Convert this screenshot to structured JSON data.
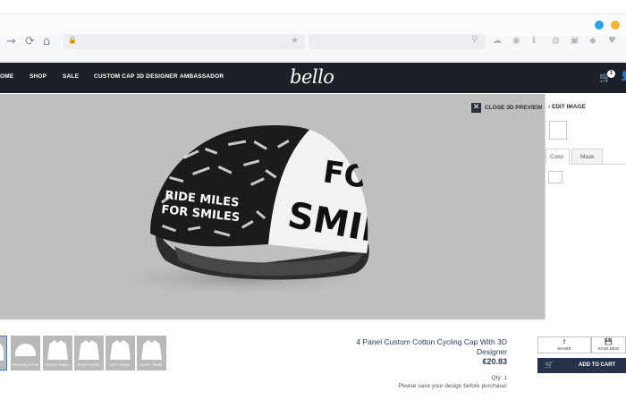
{
  "browser": {
    "nav_icons": {
      "forward": "→",
      "reload": "⟳",
      "home": "⌂"
    },
    "url_icon": "🔒",
    "bookmark_star": "★",
    "search_icon": "⚲",
    "toolbar_icons": [
      "☁",
      "◉",
      "ℹ",
      "◍",
      "▣",
      "◆",
      "♥"
    ],
    "dot_colors": [
      "#2aa5e4",
      "#f2b233"
    ]
  },
  "site_nav": {
    "items": [
      "OME",
      "SHOP",
      "SALE",
      "CUSTOM CAP 3D DESIGNER",
      "AMBASSADOR"
    ],
    "logo": "bello",
    "cart_icon": "🛒",
    "cart_count": "1",
    "user_icon": "👤"
  },
  "viewer": {
    "close_icon": "✕",
    "close_label": "CLOSE 3D PREVIEW",
    "cap_text_side": [
      "RIDE MILES",
      "FOR SMILES"
    ],
    "cap_text_front": [
      "FO",
      "SMIL"
    ]
  },
  "side_panel": {
    "edit_image_chevron": "›",
    "edit_image": "EDIT IMAGE",
    "tabs": [
      "Color",
      "Mask"
    ]
  },
  "panels": [
    "P",
    "PEAK/BOTTOM",
    "FRONT PANEL",
    "REAR PANEL",
    "LEFT PANEL",
    "RIGHT PANEL"
  ],
  "product": {
    "title": "4 Panel Custom Cotton Cycling Cap With 3D Designer",
    "price": "€20.83",
    "qty": "Qty: 1",
    "note": "Please save your design before purchase!"
  },
  "actions": {
    "share_icon": "⇪",
    "share": "SHARE",
    "save_icon": "💾",
    "save": "SAVE DESI",
    "add_to_cart_icon": "🛒",
    "add_to_cart": "ADD TO CART"
  }
}
